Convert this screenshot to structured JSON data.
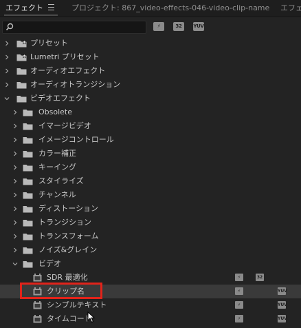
{
  "tabs": {
    "effects": "エフェクト",
    "project": "プロジェクト: 867_video-effects-046-video-clip-name",
    "right": "エフェ"
  },
  "search": {
    "value": "",
    "placeholder": ""
  },
  "filters": [
    {
      "name": "accelerated-effects",
      "label": "⚡"
    },
    {
      "name": "32bit-color",
      "label": "32"
    },
    {
      "name": "yuv-effects",
      "label": "YUV"
    }
  ],
  "tree": [
    {
      "label": "プリセット",
      "expanded": false,
      "icon": "preset-folder-icon",
      "depth": 0
    },
    {
      "label": "Lumetri プリセット",
      "expanded": false,
      "icon": "preset-folder-icon",
      "depth": 0
    },
    {
      "label": "オーディオエフェクト",
      "expanded": false,
      "icon": "folder-icon",
      "depth": 0
    },
    {
      "label": "オーディオトランジション",
      "expanded": false,
      "icon": "folder-icon",
      "depth": 0
    },
    {
      "label": "ビデオエフェクト",
      "expanded": true,
      "icon": "folder-icon",
      "depth": 0
    },
    {
      "label": "Obsolete",
      "expanded": false,
      "icon": "folder-icon",
      "depth": 1
    },
    {
      "label": "イマージビデオ",
      "expanded": false,
      "icon": "folder-icon",
      "depth": 1
    },
    {
      "label": "イメージコントロール",
      "expanded": false,
      "icon": "folder-icon",
      "depth": 1
    },
    {
      "label": "カラー補正",
      "expanded": false,
      "icon": "folder-icon",
      "depth": 1
    },
    {
      "label": "キーイング",
      "expanded": false,
      "icon": "folder-icon",
      "depth": 1
    },
    {
      "label": "スタイライズ",
      "expanded": false,
      "icon": "folder-icon",
      "depth": 1
    },
    {
      "label": "チャンネル",
      "expanded": false,
      "icon": "folder-icon",
      "depth": 1
    },
    {
      "label": "ディストーション",
      "expanded": false,
      "icon": "folder-icon",
      "depth": 1
    },
    {
      "label": "トランジション",
      "expanded": false,
      "icon": "folder-icon",
      "depth": 1
    },
    {
      "label": "トランスフォーム",
      "expanded": false,
      "icon": "folder-icon",
      "depth": 1
    },
    {
      "label": "ノイズ&グレイン",
      "expanded": false,
      "icon": "folder-icon",
      "depth": 1
    },
    {
      "label": "ビデオ",
      "expanded": true,
      "icon": "folder-icon",
      "depth": 1
    },
    {
      "label": "SDR 最適化",
      "icon": "effect-icon",
      "depth": 2,
      "badges": [
        "⚡",
        "32"
      ]
    },
    {
      "label": "クリップ名",
      "icon": "effect-icon",
      "depth": 2,
      "badges": [
        "⚡",
        "",
        "YUV"
      ],
      "selected": true
    },
    {
      "label": "シンプルテキスト",
      "icon": "effect-icon",
      "depth": 2,
      "badges": [
        "⚡",
        "",
        "YUV"
      ]
    },
    {
      "label": "タイムコード",
      "icon": "effect-icon",
      "depth": 2,
      "badges": [
        "⚡",
        "",
        "YUV"
      ]
    }
  ],
  "colors": {
    "highlight": "#e2231a",
    "background": "#232323"
  }
}
